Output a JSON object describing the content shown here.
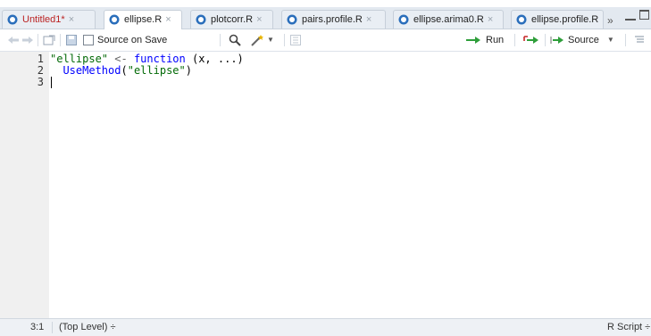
{
  "tabs": [
    {
      "label": "Untitled1*",
      "modified": true
    },
    {
      "label": "ellipse.R",
      "modified": false
    },
    {
      "label": "plotcorr.R",
      "modified": false
    },
    {
      "label": "pairs.profile.R",
      "modified": false
    },
    {
      "label": "ellipse.arima0.R",
      "modified": false
    },
    {
      "label": "ellipse.profile.R",
      "modified": false
    }
  ],
  "tab_close_glyph": "×",
  "tab_overflow_glyph": "»",
  "toolbar": {
    "source_on_save_label": "Source on Save",
    "run_label": "Run",
    "source_label": "Source"
  },
  "editor": {
    "line_numbers": [
      "1",
      "2",
      "3"
    ],
    "line1": {
      "str": "\"ellipse\"",
      "op": " <-",
      "kw": "function",
      "rest": " (x, ...)"
    },
    "line2": {
      "indent": "  ",
      "fn": "UseMethod",
      "open": "(",
      "str": "\"ellipse\"",
      "close": ")"
    }
  },
  "status": {
    "cursor_position": "3:1",
    "scope": "(Top Level) ÷",
    "file_type": "R Script ÷"
  },
  "colors": {
    "string": "#036a07",
    "keyword": "#0000ff",
    "modified_tab": "#b22222",
    "r_icon": "#2a6ebb"
  }
}
